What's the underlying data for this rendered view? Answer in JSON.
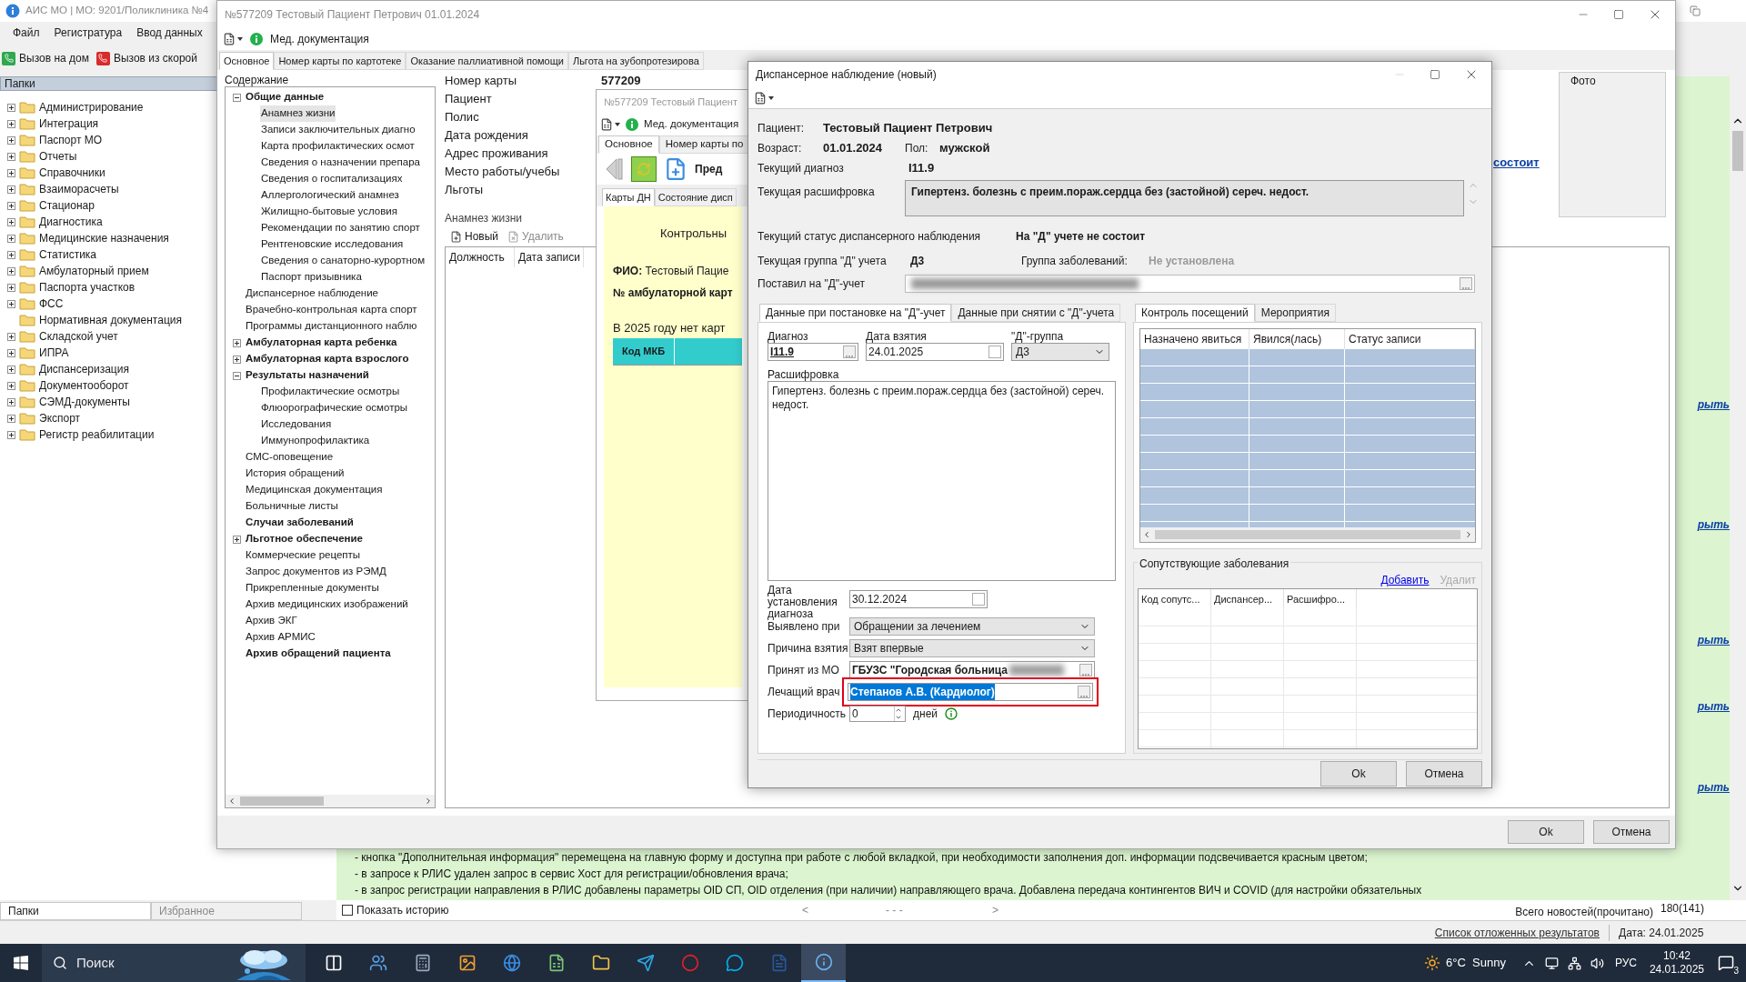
{
  "main_window": {
    "title": "АИС МО | МО: 9201/Поликлиника №4",
    "menu": [
      "Файл",
      "Регистратура",
      "Ввод данных"
    ],
    "toolbar": [
      {
        "kind": "house",
        "label": "Вызов на дом"
      },
      {
        "kind": "ambulance",
        "label": "Вызов из скорой"
      }
    ],
    "folders_title": "Папки",
    "folders": [
      {
        "label": "Администрирование",
        "expandable": true
      },
      {
        "label": "Интеграция",
        "expandable": true
      },
      {
        "label": "Паспорт МО",
        "expandable": true
      },
      {
        "label": "Отчеты",
        "expandable": true
      },
      {
        "label": "Справочники",
        "expandable": true
      },
      {
        "label": "Взаиморасчеты",
        "expandable": true
      },
      {
        "label": "Стационар",
        "expandable": true
      },
      {
        "label": "Диагностика",
        "expandable": true
      },
      {
        "label": "Медицинские назначения",
        "expandable": true
      },
      {
        "label": "Статистика",
        "expandable": true
      },
      {
        "label": "Амбулаторный прием",
        "expandable": true
      },
      {
        "label": "Паспорта участков",
        "expandable": true
      },
      {
        "label": "ФСС",
        "expandable": true
      },
      {
        "label": "Нормативная документация",
        "expandable": false
      },
      {
        "label": "Складской учет",
        "expandable": true
      },
      {
        "label": "ИПРА",
        "expandable": true
      },
      {
        "label": "Диспансеризация",
        "expandable": true
      },
      {
        "label": "Документооборот",
        "expandable": true
      },
      {
        "label": "СЭМД-документы",
        "expandable": true
      },
      {
        "label": "Экспорт",
        "expandable": true
      },
      {
        "label": "Регистр реабилитации",
        "expandable": true
      }
    ],
    "bottom_tabs": [
      {
        "label": "Папки",
        "selected": true
      },
      {
        "label": "Избранное",
        "selected": false
      }
    ],
    "news_links": [
      "рыть",
      "рыть",
      "рыть",
      "рыть",
      "рыть"
    ],
    "news_lines": [
      "- кнопка \"Дополнительная информация\" перемещена на главную форму и доступна при работе с любой вкладкой, при необходимости заполнения доп. информации подсвечивается красным цветом;",
      "- в запросе к РЛИС удален запрос в сервис Хост для регистрации/обновления врача;",
      "- в запрос регистрации направления в РЛИС добавлены параметры OID СП, OID отделения (при наличии) направляющего врача. Добавлена передача контингентов ВИЧ и COVID (для настройки обязательных"
    ],
    "show_history": {
      "label": "Показать историю",
      "checked": false
    },
    "pager": {
      "prev": "<",
      "pages": "- - -",
      "next": ">"
    },
    "news_total_label": "Всего новостей(прочитано)",
    "news_total": "180(141)",
    "status_bar": {
      "link": "Список отложенных результатов",
      "date": "Дата: 24.01.2025"
    }
  },
  "patient_window": {
    "title": "№577209 Тестовый Пациент Петрович 01.01.2024",
    "toolbar_label": "Мед. документация",
    "tabs": [
      {
        "label": "Основное",
        "selected": true
      },
      {
        "label": "Номер карты по картотеке",
        "selected": false
      },
      {
        "label": "Оказание паллиативной помощи",
        "selected": false
      },
      {
        "label": "Льгота на зубопротезирова",
        "selected": false
      }
    ],
    "contents_title": "Содержание",
    "tree": [
      {
        "label": "Общие данные",
        "bold": true,
        "expanded": true,
        "children": [
          {
            "label": "Анамнез жизни",
            "selected": true
          },
          {
            "label": "Записи заключительных диагно",
            "selected": false
          },
          {
            "label": "Карта профилактических осмот",
            "selected": false
          },
          {
            "label": "Сведения о назначении препара",
            "selected": false
          },
          {
            "label": "Сведения о госпитализациях",
            "selected": false
          },
          {
            "label": "Аллергологический анамнез",
            "selected": false
          },
          {
            "label": "Жилищно-бытовые условия",
            "selected": false
          },
          {
            "label": "Рекомендации по занятию спорт",
            "selected": false
          },
          {
            "label": "Рентгеновские исследования",
            "selected": false
          },
          {
            "label": "Сведения о санаторно-курортном",
            "selected": false
          },
          {
            "label": "Паспорт призывника",
            "selected": false
          }
        ]
      },
      {
        "label": "Диспансерное наблюдение",
        "bold": false
      },
      {
        "label": "Врачебно-контрольная карта спорт",
        "bold": false
      },
      {
        "label": "Программы дистанционного наблю",
        "bold": false
      },
      {
        "label": "Амбулаторная карта ребенка",
        "bold": true,
        "expanded": false
      },
      {
        "label": "Амбулаторная карта взрослого",
        "bold": true,
        "expanded": false
      },
      {
        "label": "Результаты назначений",
        "bold": true,
        "expanded": true,
        "children": [
          {
            "label": "Профилактические осмотры",
            "selected": false
          },
          {
            "label": "Флюорографические осмотры",
            "selected": false
          },
          {
            "label": "Исследования",
            "selected": false
          },
          {
            "label": "Иммунопрофилактика",
            "selected": false
          }
        ]
      },
      {
        "label": "СМС-оповещение",
        "bold": false
      },
      {
        "label": "История обращений",
        "bold": false
      },
      {
        "label": "Медицинская документация",
        "bold": false
      },
      {
        "label": "Больничные листы",
        "bold": false
      },
      {
        "label": "Случаи заболеваний",
        "bold": true
      },
      {
        "label": "Льготное обеспечение",
        "bold": true,
        "expanded": false
      },
      {
        "label": "Коммерческие рецепты",
        "bold": false
      },
      {
        "label": "Запрос документов из РЭМД",
        "bold": false
      },
      {
        "label": "Прикрепленные документы",
        "bold": false
      },
      {
        "label": "Архив медицинских изображений",
        "bold": false
      },
      {
        "label": "Архив ЭКГ",
        "bold": false
      },
      {
        "label": "Архив АРМИС",
        "bold": false
      },
      {
        "label": "Архив обращений пациента",
        "bold": true
      }
    ],
    "fields": [
      {
        "label": "Номер карты",
        "value": "577209"
      },
      {
        "label": "Пациент"
      },
      {
        "label": "Полис"
      },
      {
        "label": "Дата рождения"
      },
      {
        "label": "Адрес проживания"
      },
      {
        "label": "Место работы/учебы"
      },
      {
        "label": "Льготы"
      }
    ],
    "status_link": "состоит",
    "photo_label": "Фото",
    "section_title": "Анамнез жизни",
    "section_toolbar": [
      {
        "kind": "new",
        "label": "Новый",
        "disabled": false
      },
      {
        "kind": "delete",
        "label": "Удалить",
        "disabled": true
      }
    ],
    "columns": [
      "Должность",
      "Дата записи"
    ],
    "buttons": [
      "Ok",
      "Отмена"
    ]
  },
  "dn_window": {
    "title": "№577209 Тестовый Пациент",
    "toolbar_label": "Мед. документация",
    "tabs": [
      {
        "label": "Основное",
        "selected": true
      },
      {
        "label": "Номер карты по",
        "selected": false
      }
    ],
    "action_label": "Пред",
    "subtabs": [
      {
        "label": "Карты ДН",
        "selected": true
      },
      {
        "label": "Состояние дисп",
        "selected": false
      }
    ],
    "heading": "Контрольны",
    "fio_label": "ФИО:",
    "fio_value": "Тестовый Пацие",
    "card_label": "№ амбулаторной карт",
    "note": "В 2025 году нет карт",
    "table_header": "Код МКБ"
  },
  "dialog": {
    "title": "Диспансерное наблюдение (новый)",
    "patient_label": "Пациент:",
    "patient": "Тестовый Пациент Петрович",
    "age_label": "Возраст:",
    "age": "01.01.2024",
    "sex_label": "Пол:",
    "sex": "мужской",
    "diagnosis_label": "Текущий диагноз",
    "diagnosis": "I11.9",
    "decoding_label": "Текущая расшифровка",
    "decoding": "Гипертенз. болезнь с преим.пораж.сердца без (застойной) сереч. недост.",
    "status_label": "Текущий статус диспансерного наблюдения",
    "status": "На \"Д\" учете не состоит",
    "group_label": "Текущая группа \"Д\" учета",
    "group": "Д3",
    "disease_group_label": "Группа заболеваний:",
    "disease_group": "Не установлена",
    "registrar_label": "Поставил на \"Д\"-учет",
    "registrar_redacted": true,
    "left_tabs": [
      {
        "label": "Данные при постановке на \"Д\"-учет",
        "selected": true
      },
      {
        "label": "Данные при снятии с \"Д\"-учета",
        "selected": false
      }
    ],
    "diag_field": {
      "label": "Диагноз",
      "value": "I11.9"
    },
    "date_field": {
      "label": "Дата взятия",
      "value": "24.01.2025"
    },
    "dgroup_field": {
      "label": "\"Д\"-группа",
      "value": "Д3"
    },
    "text_label": "Расшифровка",
    "text": "Гипертенз. болезнь с преим.пораж.сердца без (застойной) сереч. недост.",
    "form": [
      {
        "kind": "date",
        "label": "Дата установления диагноза",
        "value": "30.12.2024"
      },
      {
        "kind": "select",
        "label": "Выявлено при",
        "value": "Обращении за лечением"
      },
      {
        "kind": "select",
        "label": "Причина взятия",
        "value": "Взят впервые"
      },
      {
        "kind": "lookup",
        "label": "Принят из МО",
        "value": "ГБУЗС \"Городская больница",
        "redacted": true,
        "highlighted": false,
        "text_selected": false
      },
      {
        "kind": "lookup",
        "label": "Лечащий врач",
        "value": "Степанов А.В. (Кардиолог)",
        "redacted": false,
        "highlighted": true,
        "text_selected": true
      },
      {
        "kind": "spin",
        "label": "Периодичность",
        "value": "0",
        "unit": "дней"
      }
    ],
    "right_tabs": [
      {
        "label": "Контроль посещений",
        "selected": true
      },
      {
        "label": "Мероприятия",
        "selected": false
      }
    ],
    "visit_columns": [
      "Назначено явиться",
      "Явился(лась)",
      "Статус записи"
    ],
    "comorbid_title": "Сопутствующие заболевания",
    "comorbid_links": [
      {
        "label": "Добавить",
        "disabled": false
      },
      {
        "label": "Удалит",
        "disabled": true
      }
    ],
    "comorbid_columns": [
      "Код сопутс...",
      "Диспансер...",
      "Расшифро..."
    ],
    "buttons": [
      "Ok",
      "Отмена"
    ]
  },
  "taskbar": {
    "search_placeholder": "Поиск",
    "apps": [
      {
        "kind": "taskview",
        "selected": false
      },
      {
        "kind": "people",
        "selected": false
      },
      {
        "kind": "calculator",
        "selected": false
      },
      {
        "kind": "photos",
        "selected": false
      },
      {
        "kind": "browser",
        "selected": false
      },
      {
        "kind": "sheet",
        "selected": false
      },
      {
        "kind": "folder",
        "selected": false
      },
      {
        "kind": "messenger",
        "selected": false
      },
      {
        "kind": "ring",
        "selected": false
      },
      {
        "kind": "chat",
        "selected": false
      },
      {
        "kind": "doc",
        "selected": false
      },
      {
        "kind": "info",
        "selected": true
      }
    ],
    "weather": "6°C  Sunny",
    "language": "РУС",
    "time": "10:42",
    "date": "24.01.2025",
    "notifications": "3"
  }
}
